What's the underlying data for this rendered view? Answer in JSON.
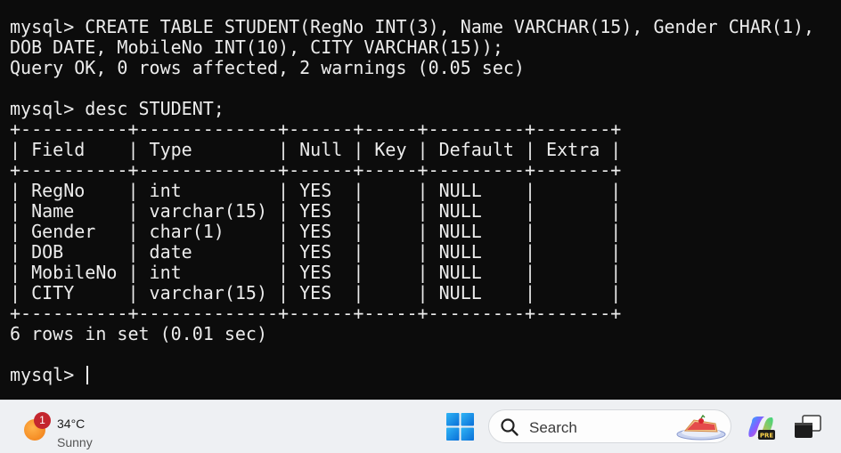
{
  "terminal": {
    "lines": [
      "mysql> CREATE TABLE STUDENT(RegNo INT(3), Name VARCHAR(15), Gender CHAR(1),",
      "DOB DATE, MobileNo INT(10), CITY VARCHAR(15));",
      "Query OK, 0 rows affected, 2 warnings (0.05 sec)",
      "",
      "mysql> desc STUDENT;",
      "+----------+-------------+------+-----+---------+-------+",
      "| Field    | Type        | Null | Key | Default | Extra |",
      "+----------+-------------+------+-----+---------+-------+",
      "| RegNo    | int         | YES  |     | NULL    |       |",
      "| Name     | varchar(15) | YES  |     | NULL    |       |",
      "| Gender   | char(1)     | YES  |     | NULL    |       |",
      "| DOB      | date        | YES  |     | NULL    |       |",
      "| MobileNo | int         | YES  |     | NULL    |       |",
      "| CITY     | varchar(15) | YES  |     | NULL    |       |",
      "+----------+-------------+------+-----+---------+-------+",
      "6 rows in set (0.01 sec)",
      "",
      "mysql> "
    ],
    "background": "#0c0c0c",
    "foreground": "#ececec"
  },
  "taskbar": {
    "weather": {
      "badge": "1",
      "temperature": "34°C",
      "condition": "Sunny",
      "icon": "sun-icon"
    },
    "start_icon": "windows-logo-icon",
    "search": {
      "placeholder": "Search",
      "icon": "search-icon",
      "highlight_icon": "pie-icon"
    },
    "copilot_icon": "copilot-icon",
    "copilot_badge": "PRE",
    "taskview_icon": "task-view-icon",
    "accent": "#0078d4"
  }
}
